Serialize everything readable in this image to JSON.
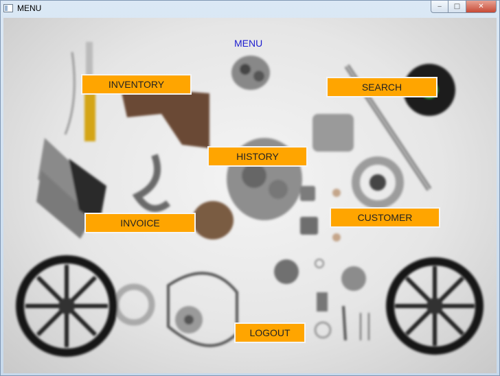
{
  "window": {
    "title": "MENU",
    "controls": {
      "minimize": "‒",
      "maximize": "□",
      "close": "✕"
    }
  },
  "menu": {
    "heading": "MENU",
    "buttons": {
      "inventory": "INVENTORY",
      "search": "SEARCH",
      "history": "HISTORY",
      "invoice": "INVOICE",
      "customer": "CUSTOMER",
      "logout": "LOGOUT"
    }
  },
  "colors": {
    "button_bg": "#ffa500",
    "heading_text": "#1c1ccf"
  }
}
